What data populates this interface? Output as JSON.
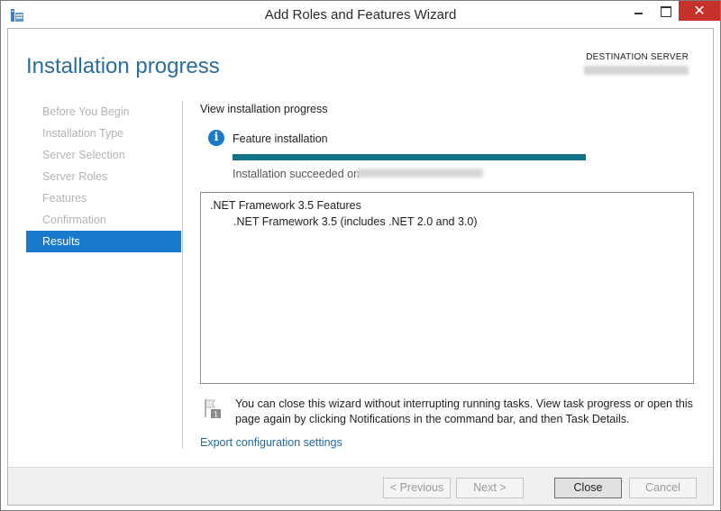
{
  "window": {
    "title": "Add Roles and Features Wizard",
    "close_glyph": "✕"
  },
  "header": {
    "page_title": "Installation progress",
    "destination_label": "DESTINATION SERVER"
  },
  "nav": {
    "items": [
      {
        "label": "Before You Begin",
        "state": "disabled"
      },
      {
        "label": "Installation Type",
        "state": "disabled"
      },
      {
        "label": "Server Selection",
        "state": "disabled"
      },
      {
        "label": "Server Roles",
        "state": "disabled"
      },
      {
        "label": "Features",
        "state": "disabled"
      },
      {
        "label": "Confirmation",
        "state": "disabled"
      },
      {
        "label": "Results",
        "state": "active"
      }
    ]
  },
  "main": {
    "heading": "View installation progress",
    "feature_label": "Feature installation",
    "progress_fraction": 1.0,
    "status_prefix": "Installation succeeded on",
    "results": [
      {
        "label": ".NET Framework 3.5 Features",
        "level": 0
      },
      {
        "label": ".NET Framework 3.5 (includes .NET 2.0 and 3.0)",
        "level": 1
      }
    ],
    "note": "You can close this wizard without interrupting running tasks. View task progress or open this page again by clicking Notifications in the command bar, and then Task Details.",
    "export_link": "Export configuration settings"
  },
  "footer": {
    "previous_label": "< Previous",
    "next_label": "Next >",
    "close_label": "Close",
    "cancel_label": "Cancel"
  },
  "colors": {
    "accent": "#1979ca",
    "title_blue": "#2a6e9c",
    "progress": "#117388",
    "window_close": "#c7312b"
  },
  "icons": {
    "app": "server-manager-icon",
    "info": "info-icon",
    "note": "flag-notification-icon"
  }
}
